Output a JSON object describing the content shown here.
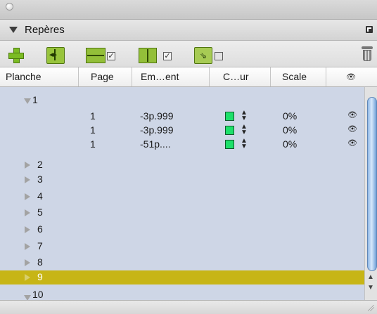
{
  "panel": {
    "title": "Repères"
  },
  "toolbar": {
    "items": [
      "add-guide-button",
      "fit-guides-button",
      "horizontal-guides-button",
      "vertical-guides-button",
      "snap-button",
      "delete-button"
    ]
  },
  "table": {
    "columns": [
      "Planche",
      "Page",
      "Em…ent",
      "C…ur",
      "Scale"
    ],
    "groups": [
      {
        "label": "1",
        "expanded": true
      },
      {
        "label": "2"
      },
      {
        "label": "3"
      },
      {
        "label": "4"
      },
      {
        "label": "5"
      },
      {
        "label": "6"
      },
      {
        "label": "7"
      },
      {
        "label": "8"
      },
      {
        "label": "9",
        "selected": true
      },
      {
        "label": "10",
        "expanded": true
      }
    ],
    "rows": [
      {
        "page": "1",
        "position": "-3p.999",
        "scale": "0%"
      },
      {
        "page": "1",
        "position": "-3p.999",
        "scale": "0%"
      },
      {
        "page": "1",
        "position": "-51p....",
        "scale": "0%"
      }
    ]
  },
  "colors": {
    "list_bg": "#ced6e6",
    "selected_row": "#c7b516",
    "swatch": "#1de06a"
  }
}
